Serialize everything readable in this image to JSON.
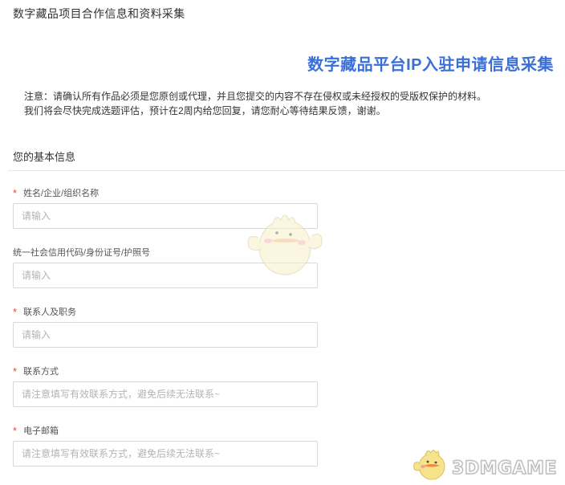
{
  "page": {
    "header": "数字藏品项目合作信息和资料采集",
    "form_title": "数字藏品平台IP入驻申请信息采集",
    "notice": [
      "注意：请确认所有作品必须是您原创或代理，并且您提交的内容不存在侵权或未经授权的受版权保护的材料。",
      "我们将会尽快完成选题评估，预计在2周内给您回复，请您耐心等待结果反馈，谢谢。"
    ]
  },
  "section": {
    "title": "您的基本信息"
  },
  "fields": [
    {
      "label": "姓名/企业/组织名称",
      "required": true,
      "required_mark": "*",
      "placeholder": "请输入",
      "value": ""
    },
    {
      "label": "统一社会信用代码/身份证号/护照号",
      "required": false,
      "required_mark": "",
      "placeholder": "请输入",
      "value": ""
    },
    {
      "label": "联系人及职务",
      "required": true,
      "required_mark": "*",
      "placeholder": "请输入",
      "value": ""
    },
    {
      "label": "联系方式",
      "required": true,
      "required_mark": "*",
      "placeholder": "请注意填写有效联系方式，避免后续无法联系~",
      "value": ""
    },
    {
      "label": "电子邮箱",
      "required": true,
      "required_mark": "*",
      "placeholder": "请注意填写有效联系方式，避免后续无法联系~",
      "value": ""
    }
  ],
  "watermark": {
    "brand": "3DMGAME",
    "mascot_icon": "chick-mascot-icon"
  },
  "colors": {
    "title_blue": "#3a6fd8",
    "required_red": "#e54b4b",
    "border_gray": "#d9d9d9",
    "placeholder_gray": "#b3b3b3"
  }
}
